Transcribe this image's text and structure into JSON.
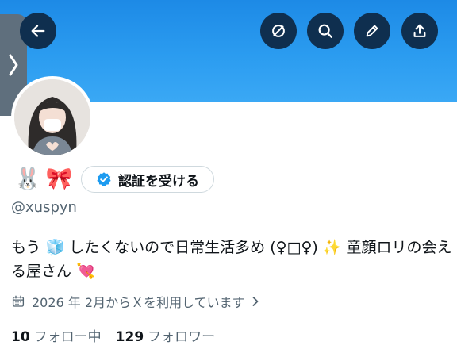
{
  "header": {
    "back_icon": "arrow-left-icon",
    "actions": [
      "block-icon",
      "search-icon",
      "pencil-icon",
      "share-icon"
    ],
    "banner_color": "#2b9cf0"
  },
  "side_tab_icon": "chevron-right-icon",
  "profile": {
    "emojis": [
      "🐰",
      "🎀"
    ],
    "verify_label": "認証を受ける",
    "handle": "@xuspyn",
    "bio": "もう 🧊 したくないので日常生活多め (♀□♀) ✨ 童顔ロリの会える屋さん 💘",
    "joined": "2026 年 2月からＸを利用しています",
    "following_count": "10",
    "following_label": "フォロー中",
    "followers_count": "129",
    "followers_label": "フォロワー"
  }
}
